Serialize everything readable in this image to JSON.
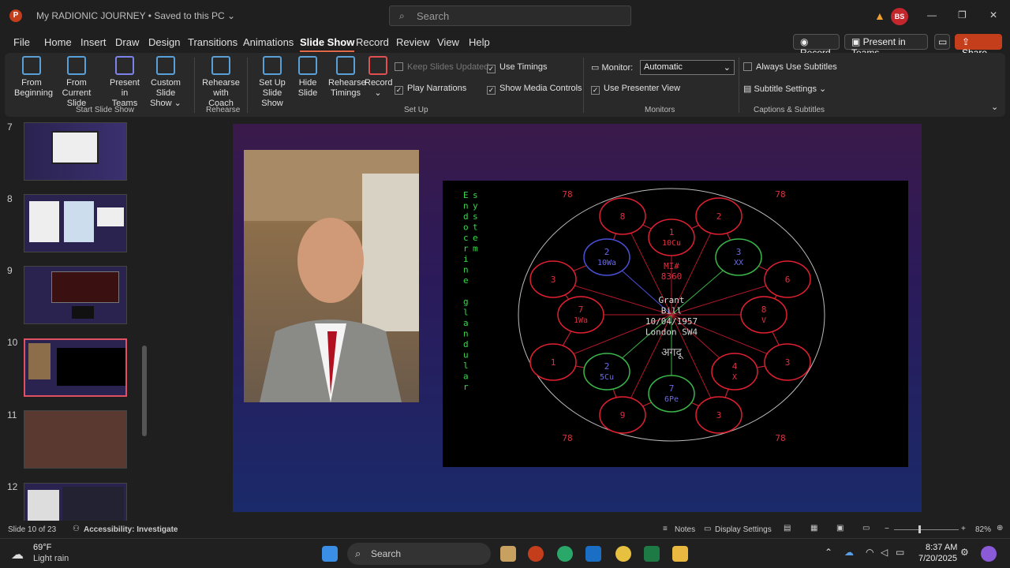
{
  "titlebar": {
    "doc_title": "My RADIONIC JOURNEY • Saved to this PC ⌄",
    "search_placeholder": "Search",
    "avatar_initials": "BS"
  },
  "tabs": [
    "File",
    "Home",
    "Insert",
    "Draw",
    "Design",
    "Transitions",
    "Animations",
    "Slide Show",
    "Record",
    "Review",
    "View",
    "Help"
  ],
  "active_tab": "Slide Show",
  "top_buttons": {
    "record": "Record",
    "present_teams": "Present in Teams",
    "share": "Share"
  },
  "ribbon": {
    "from_beginning": [
      "From",
      "Beginning"
    ],
    "from_current": [
      "From",
      "Current Slide"
    ],
    "present_teams": [
      "Present",
      "in Teams"
    ],
    "custom_show": [
      "Custom Slide",
      "Show ⌄"
    ],
    "group_start": "Start Slide Show",
    "rehearse_coach": [
      "Rehearse",
      "with Coach"
    ],
    "group_rehearse": "Rehearse",
    "setup_show": [
      "Set Up",
      "Slide Show"
    ],
    "hide_slide": [
      "Hide",
      "Slide"
    ],
    "rehearse_timings": [
      "Rehearse",
      "Timings"
    ],
    "record": [
      "Record",
      "⌄"
    ],
    "keep_updated": "Keep Slides Updated",
    "play_narrations": "Play Narrations",
    "use_timings": "Use Timings",
    "show_media": "Show Media Controls",
    "group_setup": "Set Up",
    "monitor_label": "Monitor:",
    "monitor_value": "Automatic",
    "use_presenter": "Use Presenter View",
    "group_monitors": "Monitors",
    "always_subtitles": "Always Use Subtitles",
    "subtitle_settings": "Subtitle Settings ⌄",
    "group_captions": "Captions & Subtitles"
  },
  "thumbnails": [
    "7",
    "8",
    "9",
    "10",
    "11",
    "12"
  ],
  "slide": {
    "vertical_text": "Endocrine system glandular",
    "col1": [
      "E",
      "n",
      "d",
      "o",
      "c",
      "r",
      "i",
      "n",
      "e",
      " ",
      "g",
      "l",
      "a",
      "n",
      "d",
      "u",
      "l",
      "a",
      "r"
    ],
    "col2": [
      "s",
      "y",
      "s",
      "t",
      "e",
      "m"
    ],
    "corners": [
      "78",
      "78",
      "78",
      "78"
    ],
    "center": [
      "Grant",
      "Bill",
      "10/04/1957",
      "London SW4"
    ],
    "mi": [
      "MI#",
      "8360"
    ],
    "nodes": [
      {
        "l1": "1",
        "l2": "10Cu"
      },
      {
        "l1": "2",
        "l2": ""
      },
      {
        "l1": "3",
        "l2": "XX"
      },
      {
        "l1": "6",
        "l2": ""
      },
      {
        "l1": "8",
        "l2": "V"
      },
      {
        "l1": "3",
        "l2": ""
      },
      {
        "l1": "4",
        "l2": "X"
      },
      {
        "l1": "3",
        "l2": ""
      },
      {
        "l1": "7",
        "l2": "6Pe"
      },
      {
        "l1": "9",
        "l2": ""
      },
      {
        "l1": "2",
        "l2": "5Cu"
      },
      {
        "l1": "1",
        "l2": ""
      },
      {
        "l1": "7",
        "l2": "1Wa"
      },
      {
        "l1": "3",
        "l2": ""
      },
      {
        "l1": "2",
        "l2": "10Wa"
      },
      {
        "l1": "8",
        "l2": ""
      }
    ],
    "glyph": "अगदू"
  },
  "status": {
    "slide_info": "Slide 10 of 23",
    "accessibility": "Accessibility: Investigate",
    "notes": "Notes",
    "display": "Display Settings",
    "zoom": "82%"
  },
  "taskbar": {
    "temp": "69°F",
    "weather": "Light rain",
    "search": "Search",
    "time": "8:37 AM",
    "date": "7/20/2025"
  }
}
